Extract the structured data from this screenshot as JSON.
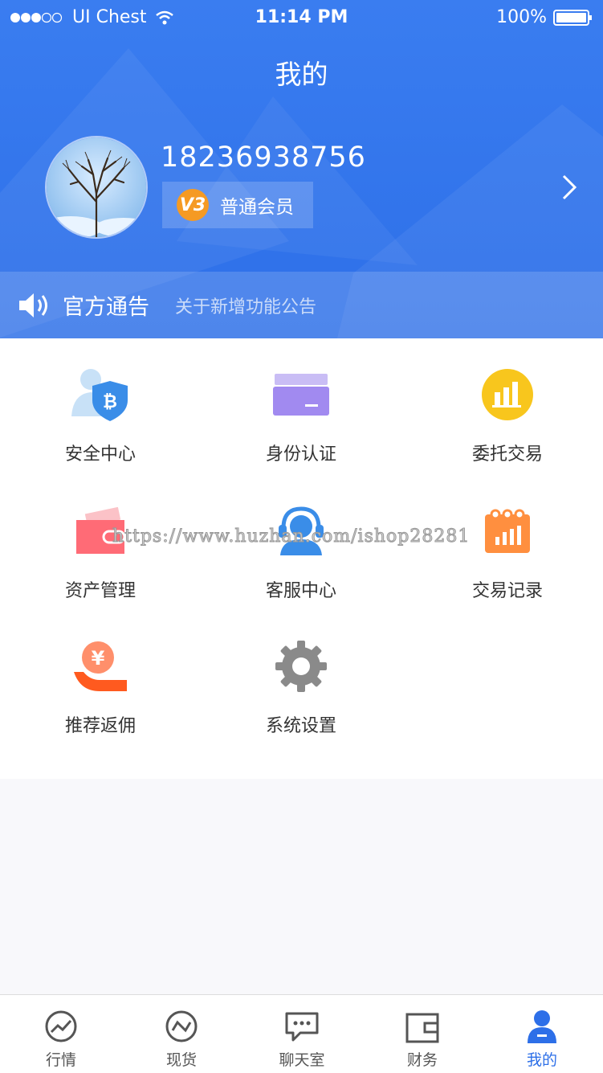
{
  "status_bar": {
    "carrier": "UI Chest",
    "time": "11:14 PM",
    "battery": "100%"
  },
  "page_title": "我的",
  "profile": {
    "phone": "18236938756",
    "badge_level": "V3",
    "badge_label": "普通会员"
  },
  "notice": {
    "title": "官方通告",
    "text": "关于新增功能公告"
  },
  "menu": [
    {
      "label": "安全中心",
      "icon": "security-shield-icon"
    },
    {
      "label": "身份认证",
      "icon": "id-card-icon"
    },
    {
      "label": "委托交易",
      "icon": "bar-chart-icon"
    },
    {
      "label": "资产管理",
      "icon": "wallet-icon"
    },
    {
      "label": "客服中心",
      "icon": "headset-icon"
    },
    {
      "label": "交易记录",
      "icon": "calendar-chart-icon"
    },
    {
      "label": "推荐返佣",
      "icon": "yuan-hand-icon"
    },
    {
      "label": "系统设置",
      "icon": "gear-icon"
    }
  ],
  "watermark": "https://www.huzhan.com/ishop28281",
  "tabs": [
    {
      "label": "行情",
      "icon": "trend-icon"
    },
    {
      "label": "现货",
      "icon": "spot-icon"
    },
    {
      "label": "聊天室",
      "icon": "chat-icon"
    },
    {
      "label": "财务",
      "icon": "wallet-outline-icon"
    },
    {
      "label": "我的",
      "icon": "user-icon",
      "active": true
    }
  ],
  "colors": {
    "primary": "#2d6fe8",
    "badge": "#f59a23"
  }
}
